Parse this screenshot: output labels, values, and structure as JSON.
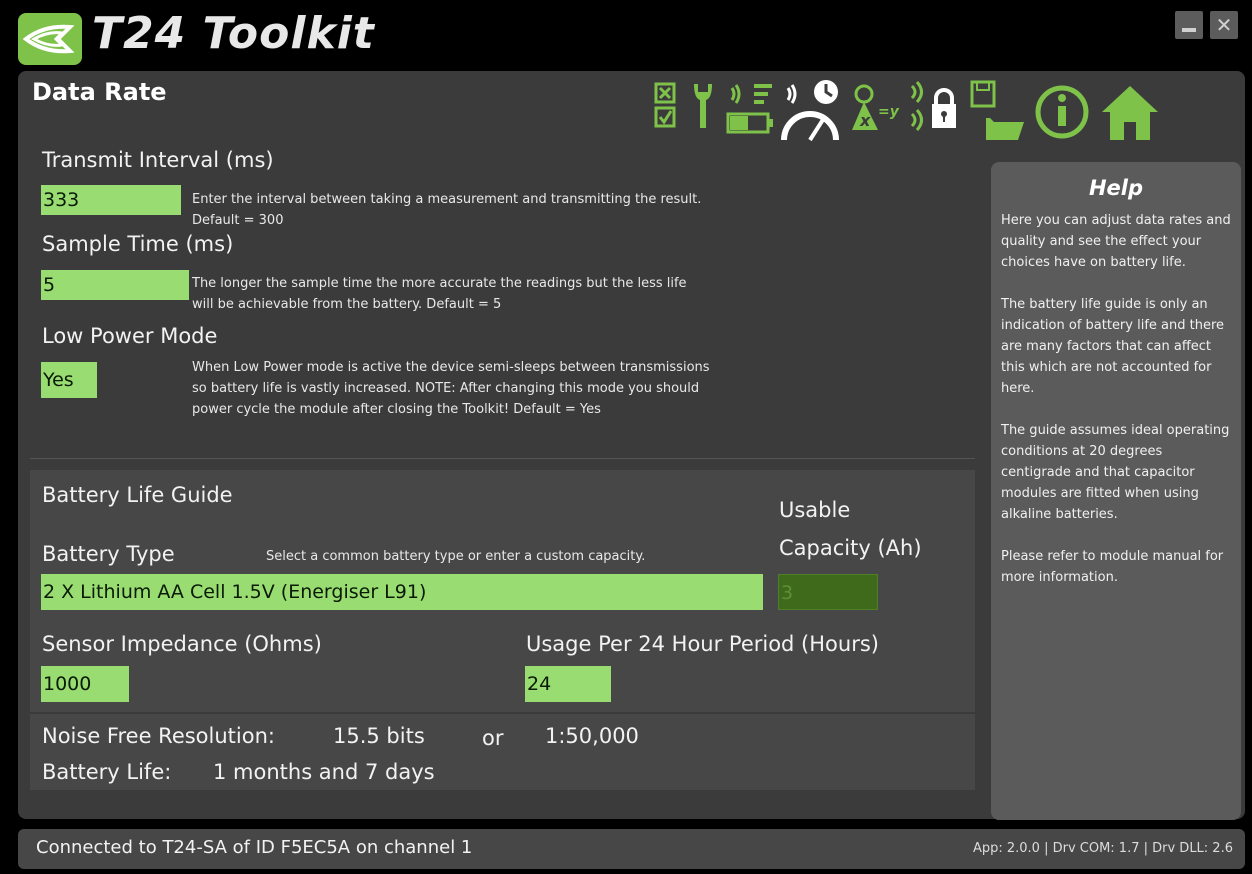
{
  "app": {
    "title": "T24 Toolkit"
  },
  "window": {
    "minimize_label": "_",
    "close_label": "✕"
  },
  "page": {
    "title": "Data Rate"
  },
  "toolbar": {
    "icons": [
      "select-all-icon",
      "wrench-icon",
      "battery-signal-icon",
      "data-rate-gauge-icon",
      "calibration-icon",
      "lock-signal-icon",
      "save-open-icon",
      "info-icon",
      "home-icon"
    ]
  },
  "settings": {
    "transmit_interval": {
      "label": "Transmit Interval (ms)",
      "value": "333",
      "help": "Enter the interval between taking a measurement and transmitting the result. Default = 300"
    },
    "sample_time": {
      "label": "Sample Time (ms)",
      "value": "5",
      "help": "The longer the sample time the more accurate the readings but the less life will be achievable from the battery. Default = 5"
    },
    "low_power_mode": {
      "label": "Low Power Mode",
      "value": "Yes",
      "help": "When Low Power mode is active the device semi-sleeps between transmissions so battery life is vastly increased. NOTE: After changing this mode you should power cycle the module after closing the Toolkit! Default = Yes"
    }
  },
  "battery": {
    "section_title": "Battery Life Guide",
    "type_label": "Battery Type",
    "type_help": "Select a common battery type or enter a custom capacity.",
    "type_value": "2 X Lithium AA Cell 1.5V (Energiser L91)",
    "capacity_label_line1": "Usable",
    "capacity_label_line2": "Capacity (Ah)",
    "capacity_value": "3",
    "impedance_label": "Sensor Impedance (Ohms)",
    "impedance_value": "1000",
    "usage_label": "Usage Per 24 Hour Period (Hours)",
    "usage_value": "24"
  },
  "results": {
    "resolution_label": "Noise Free Resolution:",
    "resolution_bits": "15.5 bits",
    "or_label": "or",
    "resolution_ratio": "1:50,000",
    "battery_life_label": "Battery Life:",
    "battery_life_value": "1 months and 7 days"
  },
  "help": {
    "title": "Help",
    "body": "Here you can adjust data rates and quality and see the effect your choices have on battery life.\n\nThe battery life guide is only an indication of battery life and there are many factors that can affect this which are not accounted for here.\n\nThe guide assumes ideal operating conditions at 20 degrees centigrade and that capacitor modules are fitted when using alkaline batteries.\n\nPlease refer to module manual for more information."
  },
  "status": {
    "connection": "Connected to T24-SA of ID F5EC5A on channel 1",
    "versions": "App: 2.0.0 | Drv COM: 1.7 | Drv DLL: 2.6"
  },
  "colors": {
    "input_fill": "#99dd72",
    "input_disabled": "#3f6a1c",
    "accent_green": "#7ec24a",
    "panel_bg": "#3b3b3b"
  }
}
